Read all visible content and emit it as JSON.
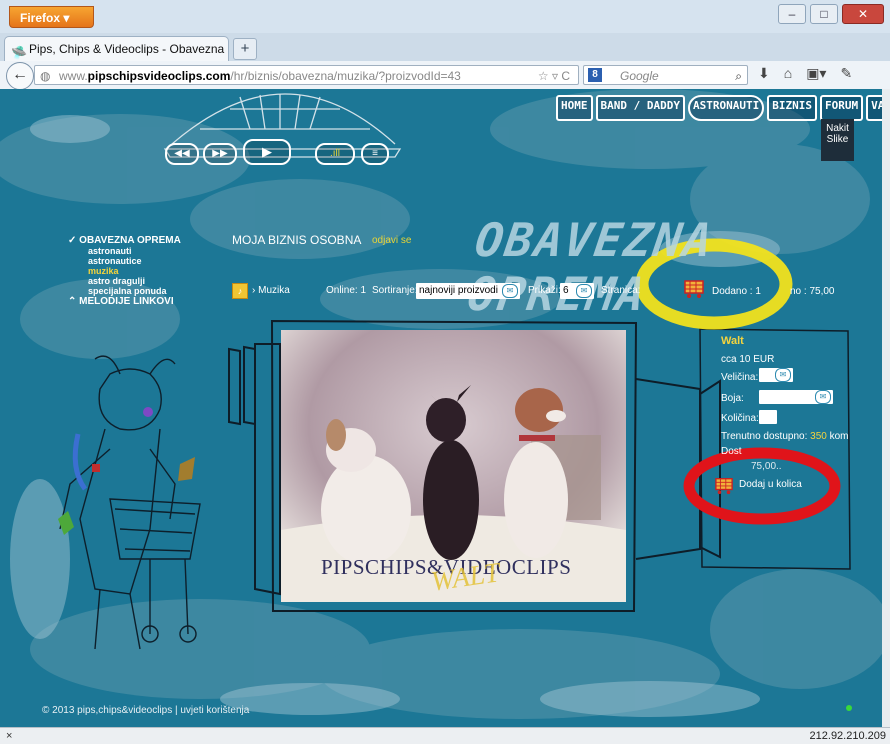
{
  "browser": {
    "app_button": "Firefox",
    "tab_title": "Pips, Chips & Videoclips - Obavezna opr...",
    "new_tab": "+",
    "url_prefix": "www.",
    "url_domain": "pipschipsvideoclips.com",
    "url_path": "/hr/biznis/obavezna/muzika/?proizvodId=43",
    "search_placeholder": "Google",
    "status_close": "×",
    "status_ip": "212.92.210.209"
  },
  "site_nav": {
    "items": [
      "HOME",
      "BAND / DADDY",
      "ASTRONAUTI",
      "BIZNIS",
      "FORUM",
      "VAYA"
    ],
    "vaya_submenu": [
      "Nakit",
      "Slike"
    ]
  },
  "left_nav": {
    "section1": "OBAVEZNA OPREMA",
    "items": [
      "astronauti",
      "astronautice",
      "muzika",
      "astro dragulji",
      "specijalna ponuda"
    ],
    "active_index": 2,
    "section2": "MELODIJE LINKOVI"
  },
  "biznis": {
    "title": "MOJA BIZNIS OSOBNA",
    "logout": "odjavi se",
    "page_heading": "OBAVEZNA OPREMA"
  },
  "toolbar": {
    "breadcrumb": "Muzika",
    "online": "Online: 1",
    "sort_label": "Sortiranje:",
    "sort_value": "najnoviji proizvodi",
    "show_label": "Prikaži:",
    "show_value": "6",
    "page_label": "Stranica:",
    "added_label": "Dodano : 1",
    "sum_label": "no : 75,00"
  },
  "product": {
    "name": "Walt",
    "price": "cca 10 EUR",
    "size_label": "Veličina:",
    "color_label": "Boja:",
    "qty_label": "Količina:",
    "stock_label": "Trenutno dostupno:",
    "stock_qty": "350",
    "stock_unit": "kom",
    "delivery_label": "Dost",
    "total_fragment": "75,00..",
    "add_to_cart": "Dodaj u kolica",
    "image_caption": "PIPSCHIPS&VIDEOCLIPS",
    "image_overlay": "WALT"
  },
  "footer": {
    "text": "© 2013 pips,chips&videoclips | uvjeti korištenja"
  },
  "colors": {
    "page_bg": "#1c7796",
    "accent_yellow": "#f4d43e",
    "highlight_yellow_ring": "#f1e21c",
    "highlight_red_ring": "#e0141a"
  }
}
